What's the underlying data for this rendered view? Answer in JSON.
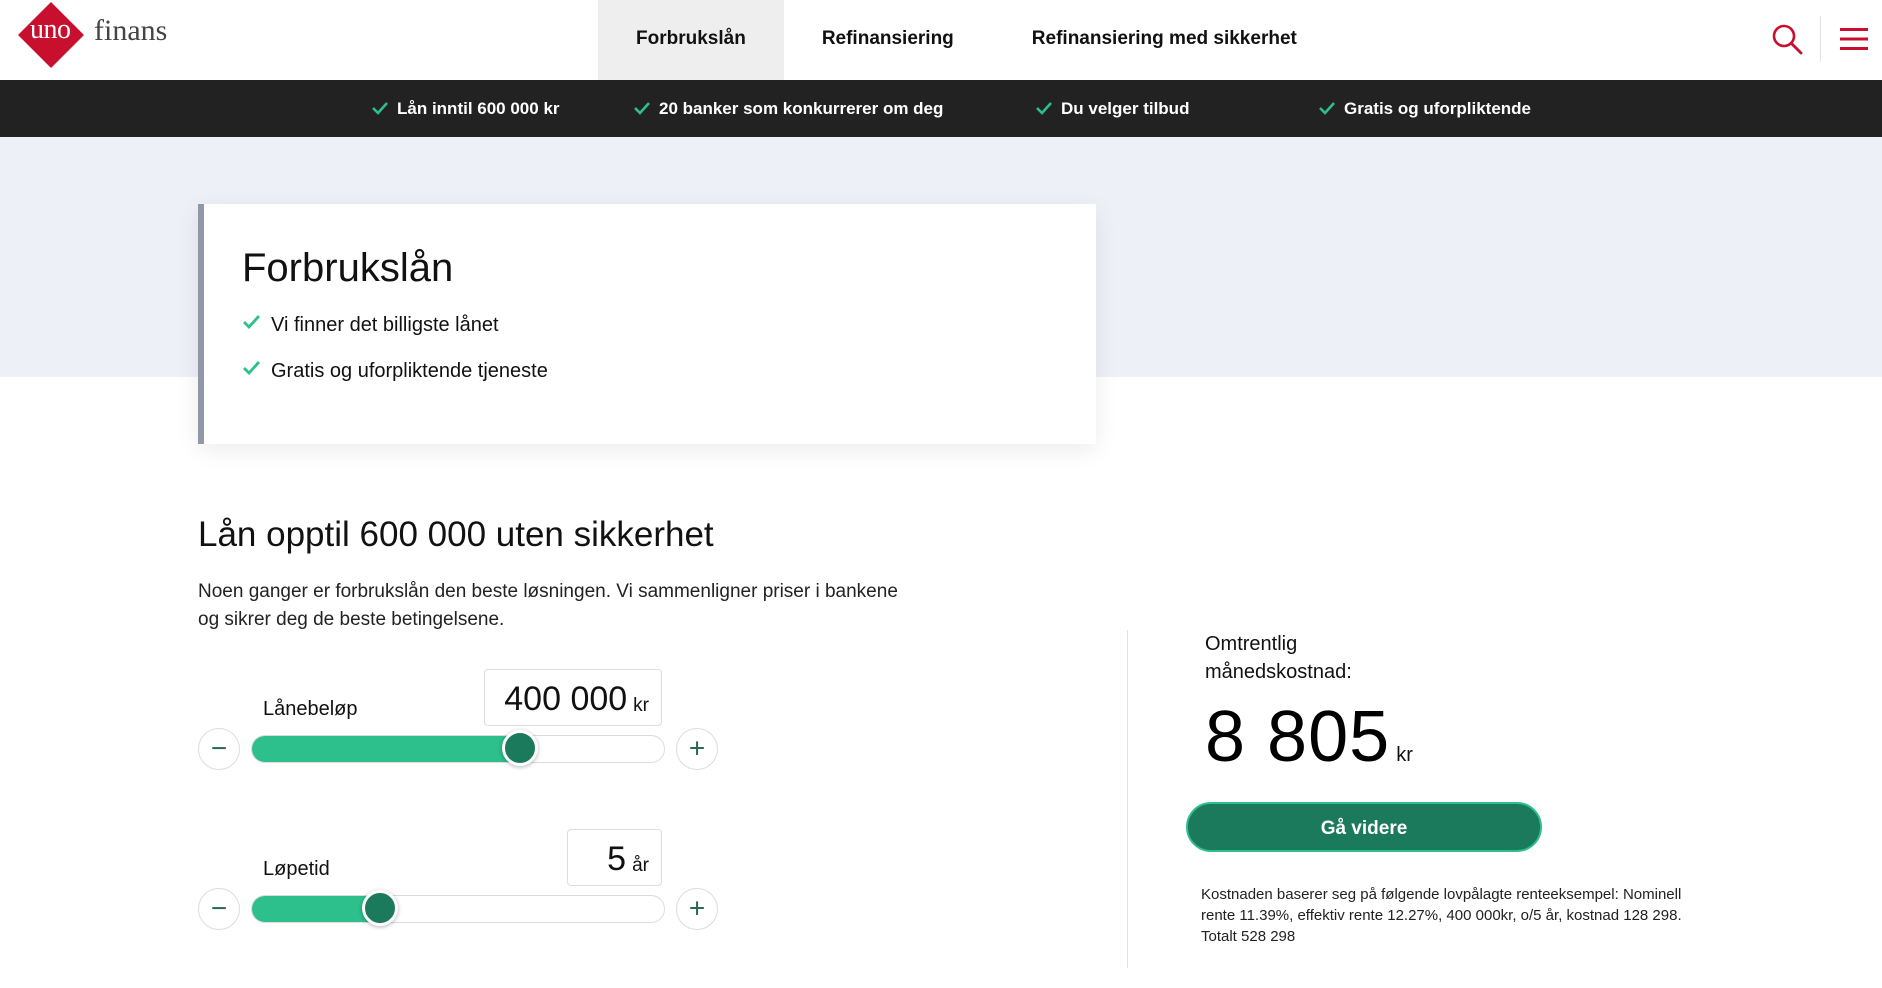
{
  "brand": {
    "logo_left": "uno",
    "logo_right": "finans",
    "logo_color": "#c8102e"
  },
  "nav": {
    "items": [
      {
        "label": "Forbrukslån",
        "active": true
      },
      {
        "label": "Refinansiering",
        "active": false
      },
      {
        "label": "Refinansiering med sikkerhet",
        "active": false
      }
    ],
    "icons": [
      "search-icon",
      "menu-icon"
    ]
  },
  "usp_bar": {
    "items": [
      {
        "label": "Lån inntil 600 000 kr"
      },
      {
        "label": "20 banker som konkurrerer om deg"
      },
      {
        "label": "Du velger tilbud"
      },
      {
        "label": "Gratis og uforpliktende"
      }
    ]
  },
  "hero": {
    "title": "Forbrukslån",
    "points": [
      {
        "label": "Vi finner det billigste lånet"
      },
      {
        "label": "Gratis og uforpliktende tjeneste"
      }
    ]
  },
  "calculator": {
    "title": "Lån opptil 600 000 uten sikkerhet",
    "description": "Noen ganger er forbrukslån den beste løsningen. Vi sammenligner priser i bankene og sikrer deg de beste betingelsene.",
    "amount": {
      "label": "Lånebeløp",
      "value": "400 000",
      "unit": "kr",
      "level": 0.65,
      "minus": "−",
      "plus": "+"
    },
    "term": {
      "label": "Løpetid",
      "value": "5",
      "unit": "år",
      "level": 0.31,
      "minus": "−",
      "plus": "+"
    }
  },
  "result": {
    "label": "Omtrentlig månedskostnad:",
    "amount": "8 805",
    "unit": "kr",
    "cta": "Gå videre",
    "fineprint": "Kostnaden baserer seg på følgende lovpålagte renteeksempel: Nominell rente 11.39%, effektiv rente 12.27%, 400 000kr, o/5 år, kostnad 128 298. Totalt 528 298"
  },
  "colors": {
    "accent_green": "#1b7a5c",
    "slider_fill": "#2dbf8c",
    "check_green": "#2dbf8c",
    "usp_bar_bg": "#222222",
    "hero_band_bg": "#eef0f8",
    "brand_red": "#c8102e"
  }
}
